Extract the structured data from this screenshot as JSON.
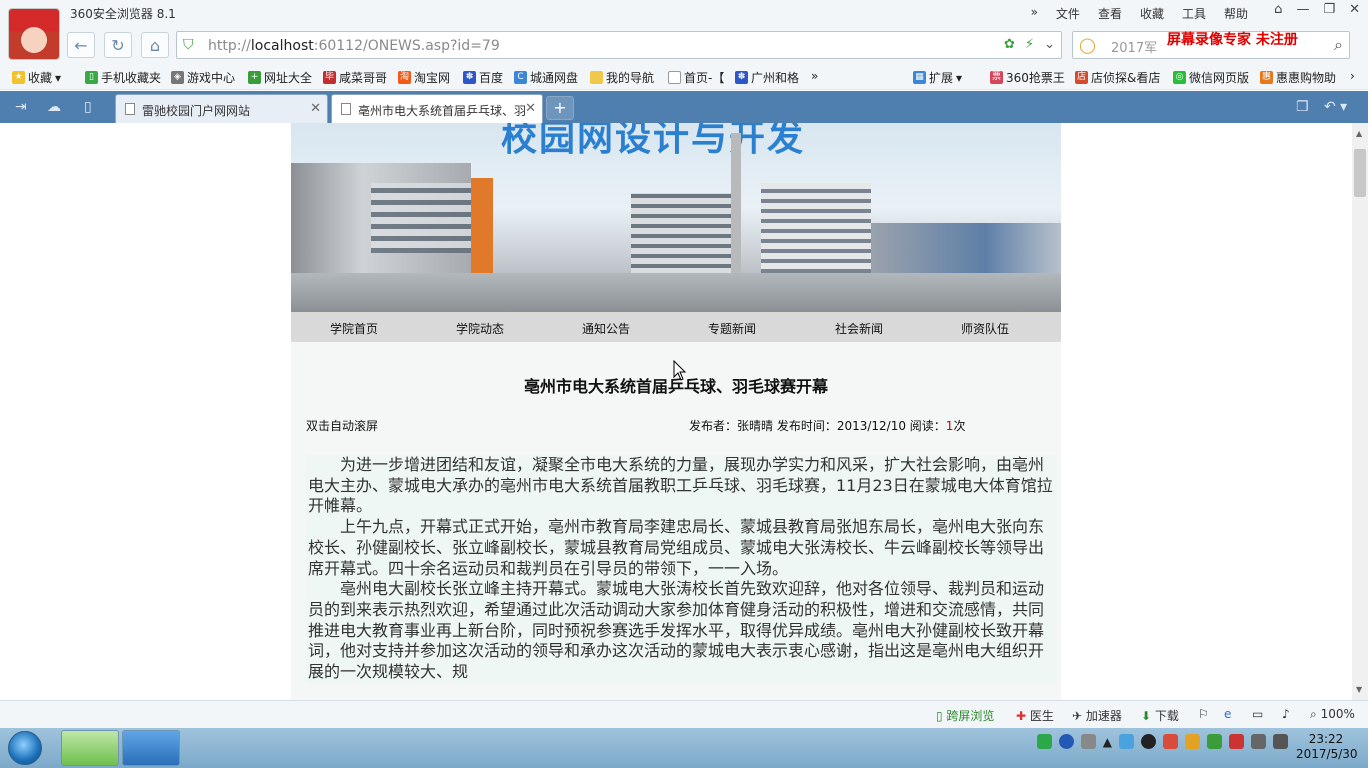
{
  "browser": {
    "window_title": "360安全浏览器 8.1",
    "menu": [
      "文件",
      "查看",
      "收藏",
      "工具",
      "帮助"
    ],
    "url_protocol": "http://",
    "url_host": "localhost",
    "url_rest": ":60112/ONEWS.asp?id=79",
    "search_placeholder": "2017军",
    "recorder_watermark": "屏幕录像专家 未注册"
  },
  "bookmarks": [
    "收藏",
    "手机收藏夹",
    "游戏中心",
    "网址大全",
    "咸菜哥哥",
    "淘宝网",
    "百度",
    "城通网盘",
    "我的导航",
    "首页-【",
    "广州和格",
    "扩展",
    "360抢票王",
    "店侦探&看店",
    "微信网页版",
    "惠惠购物助"
  ],
  "tabs": [
    {
      "label": "雷驰校园门户网网站"
    },
    {
      "label": "亳州市电大系统首届乒乓球、羽"
    }
  ],
  "page": {
    "banner_heading": "校园网设计与开发",
    "nav": [
      "学院首页",
      "学院动态",
      "通知公告",
      "专题新闻",
      "社会新闻",
      "师资队伍"
    ],
    "article_title": "亳州市电大系统首届乒乓球、羽毛球赛开幕",
    "auto_scroll": "双击自动滚屏",
    "meta_prefix": "发布者：张晴晴 发布时间：2013/12/10 阅读：",
    "views": "1",
    "meta_suffix": "次",
    "paragraphs": [
      "为进一步增进团结和友谊，凝聚全市电大系统的力量，展现办学实力和风采，扩大社会影响，由亳州电大主办、蒙城电大承办的亳州市电大系统首届教职工乒乓球、羽毛球赛，11月23日在蒙城电大体育馆拉开帷幕。",
      "上午九点，开幕式正式开始，亳州市教育局李建忠局长、蒙城县教育局张旭东局长，亳州电大张向东校长、孙健副校长、张立峰副校长，蒙城县教育局党组成员、蒙城电大张涛校长、牛云峰副校长等领导出席开幕式。四十余名运动员和裁判员在引导员的带领下，一一入场。",
      "亳州电大副校长张立峰主持开幕式。蒙城电大张涛校长首先致欢迎辞，他对各位领导、裁判员和运动员的到来表示热烈欢迎，希望通过此次活动调动大家参加体育健身活动的积极性，增进和交流感情，共同推进电大教育事业再上新台阶，同时预祝参赛选手发挥水平，取得优异成绩。亳州电大孙健副校长致开幕词，他对支持并参加这次活动的领导和承办这次活动的蒙城电大表示衷心感谢，指出这是亳州电大组织开展的一次规模较大、规"
    ]
  },
  "statusbar": {
    "items": [
      "跨屏浏览",
      "医生",
      "加速器",
      "下载"
    ],
    "zoom": "100%"
  },
  "taskbar": {
    "time": "23:22",
    "date": "2017/5/30"
  }
}
